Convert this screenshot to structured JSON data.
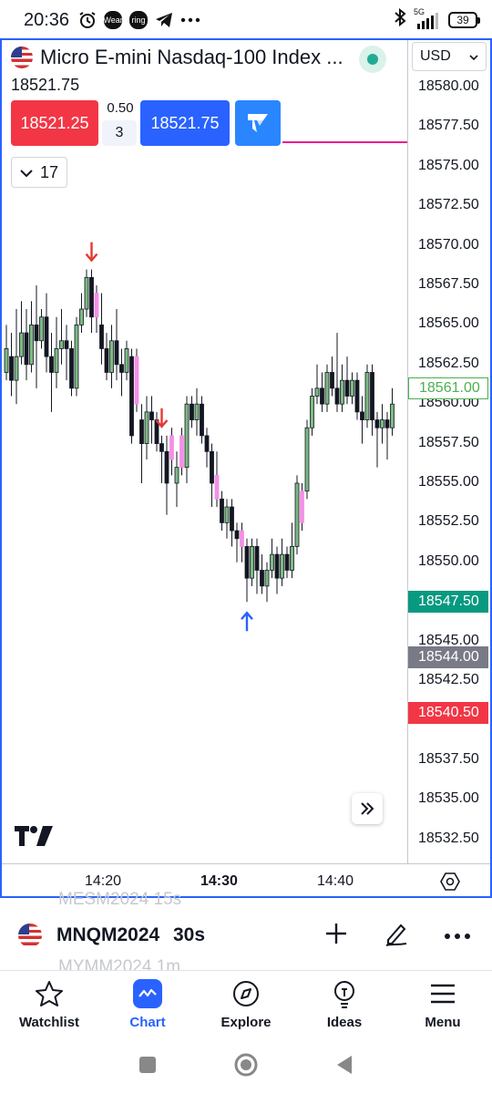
{
  "status_bar": {
    "time": "20:36",
    "wear_label": "Wear",
    "ring_label": "ring",
    "signal_label": "5G",
    "battery": "39"
  },
  "header": {
    "symbol_title": "Micro E-mini Nasdaq-100 Index ...",
    "last_price": "18521.75",
    "currency": "USD",
    "sell_price": "18521.25",
    "buy_price": "18521.75",
    "spread": "0.50",
    "quantity": "3",
    "indicators_count": "17"
  },
  "price_axis": {
    "labels": [
      "18580.00",
      "18577.50",
      "18575.00",
      "18572.50",
      "18570.00",
      "18567.50",
      "18565.00",
      "18562.50",
      "18560.00",
      "18557.50",
      "18555.00",
      "18552.50",
      "18550.00",
      "18547.50",
      "18545.00",
      "18542.50",
      "18540.00",
      "18537.50",
      "18535.00",
      "18532.50"
    ],
    "badges": [
      {
        "text": "18561.00",
        "style": "outline",
        "color": "#4caf50",
        "value": 18561.0
      },
      {
        "text": "18547.50",
        "style": "fill",
        "color": "#089981",
        "value": 18547.5
      },
      {
        "text": "18544.00",
        "style": "fill",
        "color": "#787b86",
        "value": 18544.0
      },
      {
        "text": "18540.50",
        "style": "fill",
        "color": "#f23645",
        "value": 18540.5
      }
    ]
  },
  "time_axis": {
    "labels": [
      "14:20",
      "14:30",
      "14:40"
    ],
    "highlighted": "14:30"
  },
  "chart_data": {
    "type": "candlestick",
    "y_range": [
      18530.0,
      18582.0
    ],
    "up_color": "#7dba82",
    "down_color": "#131722",
    "highlight_color": "#f48fe6",
    "candles": [
      {
        "o": 18562.0,
        "c": 18563.5,
        "h": 18565.0,
        "l": 18561.5
      },
      {
        "o": 18563.0,
        "c": 18561.5,
        "h": 18564.5,
        "l": 18560.5
      },
      {
        "o": 18561.5,
        "c": 18563.0,
        "h": 18566.0,
        "l": 18560.0
      },
      {
        "o": 18563.0,
        "c": 18564.5,
        "h": 18566.5,
        "l": 18562.5
      },
      {
        "o": 18564.5,
        "c": 18562.5,
        "h": 18566.0,
        "l": 18561.5
      },
      {
        "o": 18562.5,
        "c": 18565.0,
        "h": 18566.5,
        "l": 18562.0
      },
      {
        "o": 18565.0,
        "c": 18564.0,
        "h": 18567.5,
        "l": 18561.0
      },
      {
        "o": 18564.0,
        "c": 18565.5,
        "h": 18566.0,
        "l": 18563.5
      },
      {
        "o": 18565.5,
        "c": 18563.0,
        "h": 18567.0,
        "l": 18562.0
      },
      {
        "o": 18563.0,
        "c": 18562.0,
        "h": 18564.5,
        "l": 18559.5
      },
      {
        "o": 18562.0,
        "c": 18563.5,
        "h": 18565.5,
        "l": 18561.0
      },
      {
        "o": 18563.5,
        "c": 18564.0,
        "h": 18566.0,
        "l": 18562.5
      },
      {
        "o": 18564.0,
        "c": 18563.5,
        "h": 18565.0,
        "l": 18561.5
      },
      {
        "o": 18563.5,
        "c": 18561.0,
        "h": 18564.0,
        "l": 18560.5
      },
      {
        "o": 18561.0,
        "c": 18565.0,
        "h": 18565.5,
        "l": 18560.5
      },
      {
        "o": 18565.0,
        "c": 18566.0,
        "h": 18567.0,
        "l": 18564.5
      },
      {
        "o": 18566.0,
        "c": 18568.0,
        "h": 18568.5,
        "l": 18565.5
      },
      {
        "o": 18568.0,
        "c": 18565.5,
        "h": 18568.5,
        "l": 18564.5
      },
      {
        "o": 18565.5,
        "c": 18567.0,
        "h": 18567.5,
        "l": 18564.5,
        "hl": true
      },
      {
        "o": 18565.0,
        "c": 18563.5,
        "h": 18567.0,
        "l": 18562.5
      },
      {
        "o": 18563.5,
        "c": 18562.0,
        "h": 18564.5,
        "l": 18561.5
      },
      {
        "o": 18562.0,
        "c": 18564.0,
        "h": 18565.0,
        "l": 18561.0
      },
      {
        "o": 18564.0,
        "c": 18562.5,
        "h": 18566.0,
        "l": 18561.5
      },
      {
        "o": 18562.5,
        "c": 18562.0,
        "h": 18563.5,
        "l": 18560.5
      },
      {
        "o": 18562.0,
        "c": 18563.5,
        "h": 18564.0,
        "l": 18561.5
      },
      {
        "o": 18563.0,
        "c": 18558.0,
        "h": 18563.5,
        "l": 18557.5
      },
      {
        "o": 18563.0,
        "c": 18560.0,
        "h": 18563.5,
        "l": 18559.5,
        "hl": true
      },
      {
        "o": 18559.0,
        "c": 18557.5,
        "h": 18560.0,
        "l": 18555.0
      },
      {
        "o": 18557.5,
        "c": 18559.5,
        "h": 18560.5,
        "l": 18556.5
      },
      {
        "o": 18559.5,
        "c": 18559.0,
        "h": 18560.5,
        "l": 18557.5
      },
      {
        "o": 18559.0,
        "c": 18557.5,
        "h": 18559.5,
        "l": 18557.0
      },
      {
        "o": 18557.5,
        "c": 18557.0,
        "h": 18558.0,
        "l": 18555.0
      },
      {
        "o": 18557.0,
        "c": 18555.0,
        "h": 18558.0,
        "l": 18553.0
      },
      {
        "o": 18558.0,
        "c": 18556.5,
        "h": 18558.5,
        "l": 18555.5,
        "hl": true
      },
      {
        "o": 18555.0,
        "c": 18556.0,
        "h": 18557.0,
        "l": 18553.5
      },
      {
        "o": 18556.0,
        "c": 18558.0,
        "h": 18558.5,
        "l": 18555.5,
        "hl": true
      },
      {
        "o": 18556.0,
        "c": 18560.0,
        "h": 18560.5,
        "l": 18555.0
      },
      {
        "o": 18560.0,
        "c": 18559.0,
        "h": 18560.5,
        "l": 18558.5
      },
      {
        "o": 18559.0,
        "c": 18560.0,
        "h": 18561.0,
        "l": 18558.0
      },
      {
        "o": 18560.0,
        "c": 18558.0,
        "h": 18560.5,
        "l": 18557.5
      },
      {
        "o": 18558.0,
        "c": 18557.0,
        "h": 18558.5,
        "l": 18556.0
      },
      {
        "o": 18557.0,
        "c": 18555.0,
        "h": 18557.5,
        "l": 18553.5
      },
      {
        "o": 18555.5,
        "c": 18554.0,
        "h": 18557.0,
        "l": 18553.5,
        "hl": true
      },
      {
        "o": 18554.0,
        "c": 18552.5,
        "h": 18554.5,
        "l": 18552.0
      },
      {
        "o": 18552.5,
        "c": 18553.5,
        "h": 18554.0,
        "l": 18551.5
      },
      {
        "o": 18553.5,
        "c": 18552.0,
        "h": 18554.0,
        "l": 18551.0
      },
      {
        "o": 18552.0,
        "c": 18551.5,
        "h": 18552.5,
        "l": 18550.0
      },
      {
        "o": 18552.0,
        "c": 18551.0,
        "h": 18552.5,
        "l": 18550.0,
        "hl": true
      },
      {
        "o": 18551.0,
        "c": 18549.0,
        "h": 18551.5,
        "l": 18547.5
      },
      {
        "o": 18549.0,
        "c": 18551.0,
        "h": 18551.5,
        "l": 18548.5
      },
      {
        "o": 18551.0,
        "c": 18549.5,
        "h": 18551.5,
        "l": 18548.0
      },
      {
        "o": 18549.5,
        "c": 18548.5,
        "h": 18550.5,
        "l": 18548.0
      },
      {
        "o": 18548.5,
        "c": 18549.5,
        "h": 18550.0,
        "l": 18547.5
      },
      {
        "o": 18549.5,
        "c": 18550.5,
        "h": 18551.5,
        "l": 18549.0
      },
      {
        "o": 18550.5,
        "c": 18549.0,
        "h": 18551.0,
        "l": 18548.0
      },
      {
        "o": 18549.0,
        "c": 18550.5,
        "h": 18551.5,
        "l": 18548.5
      },
      {
        "o": 18550.5,
        "c": 18549.5,
        "h": 18551.0,
        "l": 18549.0
      },
      {
        "o": 18549.5,
        "c": 18551.0,
        "h": 18552.5,
        "l": 18549.0
      },
      {
        "o": 18551.0,
        "c": 18555.0,
        "h": 18555.5,
        "l": 18550.5
      },
      {
        "o": 18552.5,
        "c": 18554.5,
        "h": 18555.0,
        "l": 18552.0,
        "hl": true
      },
      {
        "o": 18554.5,
        "c": 18558.5,
        "h": 18559.0,
        "l": 18554.0
      },
      {
        "o": 18558.5,
        "c": 18560.5,
        "h": 18561.0,
        "l": 18558.0
      },
      {
        "o": 18560.5,
        "c": 18561.0,
        "h": 18562.5,
        "l": 18560.0
      },
      {
        "o": 18561.0,
        "c": 18560.0,
        "h": 18562.0,
        "l": 18559.5
      },
      {
        "o": 18560.0,
        "c": 18562.0,
        "h": 18562.5,
        "l": 18559.5
      },
      {
        "o": 18562.0,
        "c": 18561.0,
        "h": 18563.0,
        "l": 18560.5
      },
      {
        "o": 18561.0,
        "c": 18560.0,
        "h": 18564.5,
        "l": 18559.5
      },
      {
        "o": 18560.0,
        "c": 18561.5,
        "h": 18562.5,
        "l": 18559.5
      },
      {
        "o": 18561.5,
        "c": 18560.5,
        "h": 18563.0,
        "l": 18560.0
      },
      {
        "o": 18560.5,
        "c": 18561.5,
        "h": 18562.0,
        "l": 18560.0
      },
      {
        "o": 18561.5,
        "c": 18559.5,
        "h": 18562.0,
        "l": 18559.0
      },
      {
        "o": 18559.5,
        "c": 18559.0,
        "h": 18560.5,
        "l": 18557.5
      },
      {
        "o": 18559.0,
        "c": 18562.0,
        "h": 18562.5,
        "l": 18558.5
      },
      {
        "o": 18562.0,
        "c": 18559.0,
        "h": 18562.5,
        "l": 18558.0
      },
      {
        "o": 18559.0,
        "c": 18558.5,
        "h": 18559.5,
        "l": 18556.0
      },
      {
        "o": 18558.5,
        "c": 18559.0,
        "h": 18560.0,
        "l": 18557.5
      },
      {
        "o": 18559.0,
        "c": 18558.5,
        "h": 18559.5,
        "l": 18556.5
      },
      {
        "o": 18558.5,
        "c": 18560.0,
        "h": 18561.0,
        "l": 18558.0
      }
    ],
    "markers": [
      {
        "type": "down-arrow",
        "index": 17,
        "color": "#e53935"
      },
      {
        "type": "down-arrow",
        "index": 31,
        "color": "#e53935"
      },
      {
        "type": "up-arrow",
        "index": 48,
        "color": "#2962ff"
      }
    ]
  },
  "symbol_strip": {
    "prev_symbol": "MESM2024  15s",
    "symbol": "MNQM2024",
    "interval": "30s",
    "next_symbol": "MYMM2024  1m"
  },
  "bottom_nav": [
    {
      "label": "Watchlist",
      "icon": "star-icon"
    },
    {
      "label": "Chart",
      "icon": "chart-icon"
    },
    {
      "label": "Explore",
      "icon": "compass-icon"
    },
    {
      "label": "Ideas",
      "icon": "lightbulb-icon"
    },
    {
      "label": "Menu",
      "icon": "hamburger-icon"
    }
  ]
}
